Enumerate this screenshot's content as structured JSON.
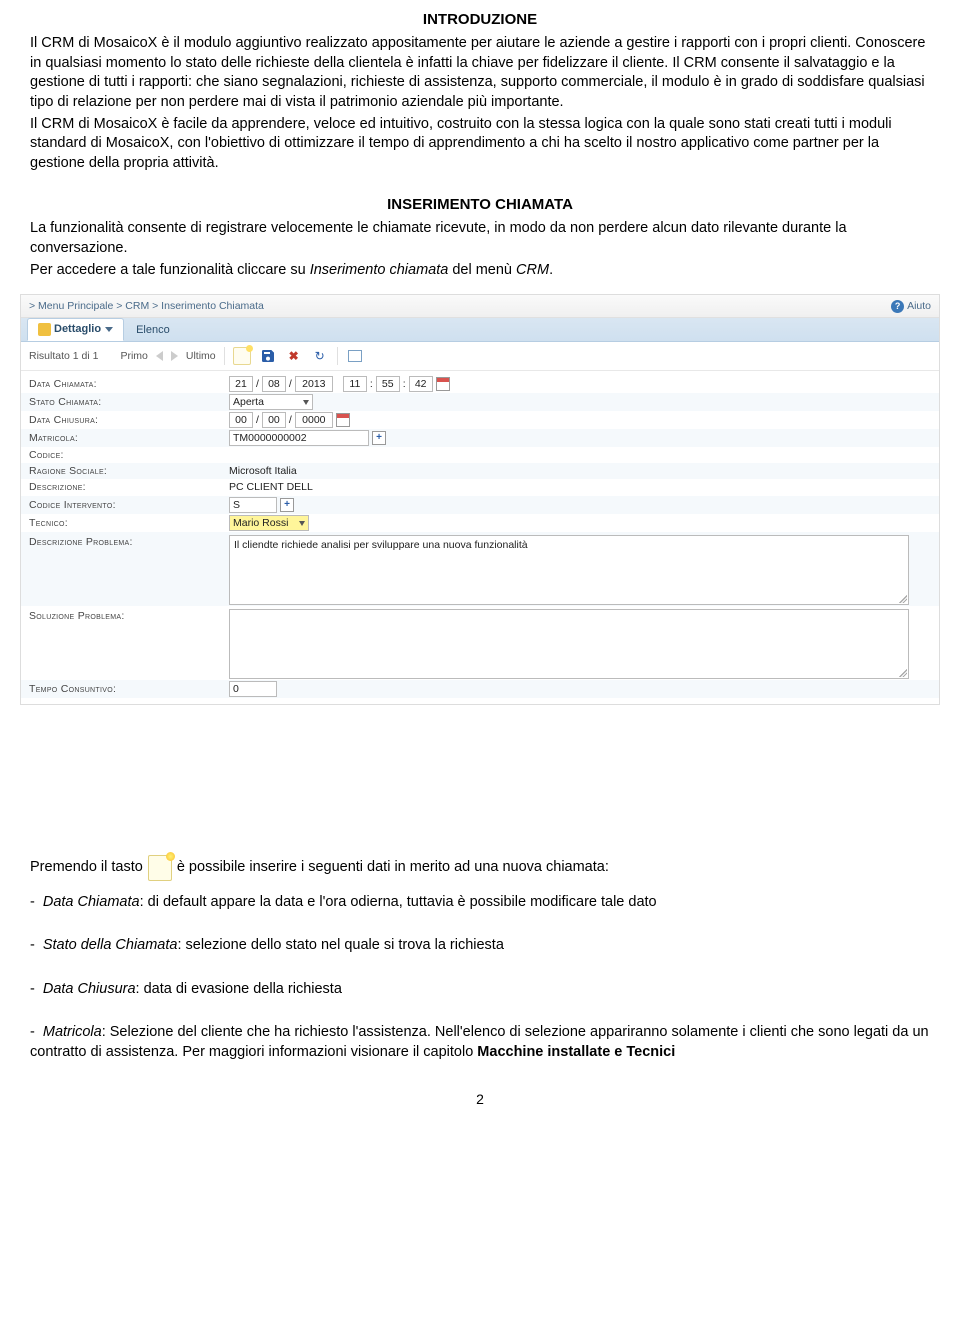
{
  "heading1": "INTRODUZIONE",
  "intro": {
    "p1": "Il CRM di MosaicoX è il modulo aggiuntivo realizzato appositamente per aiutare le aziende a gestire i rapporti con i propri clienti. Conoscere in qualsiasi momento lo stato delle richieste della clientela è infatti la chiave per fidelizzare il cliente. Il CRM consente il salvataggio e la gestione di tutti i rapporti: che siano segnalazioni, richieste di assistenza, supporto commerciale, il modulo è in grado di soddisfare qualsiasi tipo di relazione per non perdere mai di vista il patrimonio aziendale più importante.",
    "p2": "Il CRM di MosaicoX è facile da apprendere, veloce ed intuitivo, costruito con la stessa logica con la quale sono stati creati tutti i moduli standard di MosaicoX, con l'obiettivo di ottimizzare il tempo di apprendimento a chi ha scelto il nostro applicativo come partner per la gestione della propria attività."
  },
  "heading2": "INSERIMENTO CHIAMATA",
  "sec2": {
    "p1": "La funzionalità consente di registrare velocemente le chiamate ricevute, in modo da non perdere alcun dato rilevante durante la conversazione.",
    "p2a": "Per accedere a tale funzionalità cliccare su ",
    "p2b": "Inserimento chiamata",
    "p2c": " del menù ",
    "p2d": "CRM",
    "p2e": "."
  },
  "screenshot": {
    "breadcrumb": "> Menu Principale > CRM > Inserimento Chiamata",
    "help": "Aiuto",
    "tabs": {
      "dettaglio": "Dettaglio",
      "elenco": "Elenco"
    },
    "toolbar": {
      "risultato": "Risultato 1 di 1",
      "primo": "Primo",
      "ultimo": "Ultimo"
    },
    "labels": {
      "data_chiamata": "Data Chiamata:",
      "stato_chiamata": "Stato Chiamata:",
      "data_chiusura": "Data Chiusura:",
      "matricola": "Matricola:",
      "codice": "Codice:",
      "ragione_sociale": "Ragione Sociale:",
      "descrizione": "Descrizione:",
      "codice_intervento": "Codice Intervento:",
      "tecnico": "Tecnico:",
      "descr_problema": "Descrizione Problema:",
      "sol_problema": "Soluzione Problema:",
      "tempo": "Tempo Consuntivo:"
    },
    "values": {
      "date_d": "21",
      "date_m": "08",
      "date_y": "2013",
      "time_h": "11",
      "time_m": "55",
      "time_s": "42",
      "stato": "Aperta",
      "close_d": "00",
      "close_m": "00",
      "close_y": "0000",
      "matricola": "TM0000000002",
      "ragione": "Microsoft Italia",
      "descr": "PC CLIENT DELL",
      "cod_int": "S",
      "tecnico": "Mario Rossi",
      "problema": "Il cliendte richiede analisi per sviluppare una nuova funzionalità",
      "tempo": "0"
    }
  },
  "press": {
    "a": "Premendo il tasto",
    "b": "è possibile inserire i seguenti dati in merito ad una nuova chiamata:"
  },
  "bullets": {
    "b1a": "Data Chiamata",
    "b1b": ": di default appare la data e l'ora odierna, tuttavia è possibile modificare tale dato",
    "b2a": "Stato della Chiamata",
    "b2b": ": selezione dello stato nel quale si trova la richiesta",
    "b3a": "Data Chiusura",
    "b3b": ": data di evasione della richiesta",
    "b4a": "Matricola",
    "b4b": ": Selezione del cliente che ha richiesto l'assistenza. Nell'elenco di selezione appariranno solamente i clienti che sono legati da un contratto di assistenza. Per maggiori informazioni visionare il capitolo ",
    "b4c": "Macchine installate e Tecnici"
  },
  "pagenum": "2",
  "slash": "/",
  "colon": ":",
  "dash": "- "
}
